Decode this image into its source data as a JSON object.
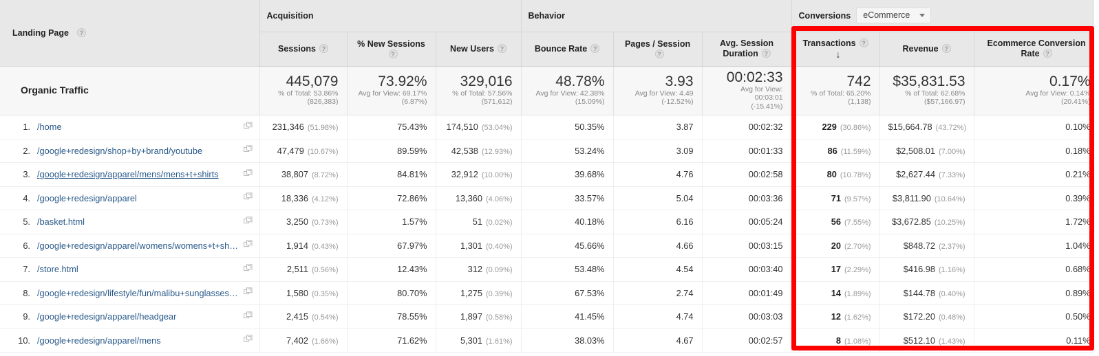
{
  "dimension": {
    "label": "Landing Page",
    "help_icon": "help-icon"
  },
  "groups": {
    "acquisition": "Acquisition",
    "behavior": "Behavior",
    "conversions": "Conversions",
    "conversions_select": "eCommerce"
  },
  "metrics": {
    "sessions": "Sessions",
    "pct_new_sessions": "% New Sessions",
    "new_users": "New Users",
    "bounce_rate": "Bounce Rate",
    "pages_session": "Pages / Session",
    "avg_session_duration": "Avg. Session Duration",
    "transactions": "Transactions",
    "revenue": "Revenue",
    "ecommerce_conversion_rate": "Ecommerce Conversion Rate"
  },
  "sort": {
    "column": "Transactions",
    "direction_icon": "arrow-down-icon",
    "direction_glyph": "↓"
  },
  "summary": {
    "label": "Organic Traffic",
    "sessions": {
      "value": "445,079",
      "line1": "% of Total: 53.86%",
      "line2": "(826,383)"
    },
    "pct_new_sessions": {
      "value": "73.92%",
      "line1": "Avg for View: 69.17%",
      "line2": "(6.87%)"
    },
    "new_users": {
      "value": "329,016",
      "line1": "% of Total: 57.56%",
      "line2": "(571,612)"
    },
    "bounce_rate": {
      "value": "48.78%",
      "line1": "Avg for View: 42.38%",
      "line2": "(15.09%)"
    },
    "pages_session": {
      "value": "3.93",
      "line1": "Avg for View: 4.49",
      "line2": "(-12.52%)"
    },
    "avg_session_duration": {
      "value": "00:02:33",
      "line1": "Avg for View: 00:03:01",
      "line2": "(-15.41%)"
    },
    "transactions": {
      "value": "742",
      "line1": "% of Total: 65.20%",
      "line2": "(1,138)"
    },
    "revenue": {
      "value": "$35,831.53",
      "line1": "% of Total: 62.68%",
      "line2": "($57,166.97)"
    },
    "ecommerce_conversion_rate": {
      "value": "0.17%",
      "line1": "Avg for View: 0.14%",
      "line2": "(20.41%)"
    }
  },
  "rows": [
    {
      "rank": "1.",
      "path": "/home",
      "hovered": false,
      "sessions": "231,346",
      "sessions_pct": "(51.98%)",
      "pct_new_sessions": "75.43%",
      "new_users": "174,510",
      "new_users_pct": "(53.04%)",
      "bounce_rate": "50.35%",
      "pages_session": "3.87",
      "avg_session_duration": "00:02:32",
      "transactions": "229",
      "transactions_pct": "(30.86%)",
      "revenue": "$15,664.78",
      "revenue_pct": "(43.72%)",
      "ecommerce_conversion_rate": "0.10%"
    },
    {
      "rank": "2.",
      "path": "/google+redesign/shop+by+brand/youtube",
      "hovered": false,
      "sessions": "47,479",
      "sessions_pct": "(10.67%)",
      "pct_new_sessions": "89.59%",
      "new_users": "42,538",
      "new_users_pct": "(12.93%)",
      "bounce_rate": "53.24%",
      "pages_session": "3.09",
      "avg_session_duration": "00:01:33",
      "transactions": "86",
      "transactions_pct": "(11.59%)",
      "revenue": "$2,508.01",
      "revenue_pct": "(7.00%)",
      "ecommerce_conversion_rate": "0.18%"
    },
    {
      "rank": "3.",
      "path": "/google+redesign/apparel/mens/mens+t+shirts",
      "hovered": true,
      "sessions": "38,807",
      "sessions_pct": "(8.72%)",
      "pct_new_sessions": "84.81%",
      "new_users": "32,912",
      "new_users_pct": "(10.00%)",
      "bounce_rate": "39.68%",
      "pages_session": "4.76",
      "avg_session_duration": "00:02:58",
      "transactions": "80",
      "transactions_pct": "(10.78%)",
      "revenue": "$2,627.44",
      "revenue_pct": "(7.33%)",
      "ecommerce_conversion_rate": "0.21%"
    },
    {
      "rank": "4.",
      "path": "/google+redesign/apparel",
      "hovered": false,
      "sessions": "18,336",
      "sessions_pct": "(4.12%)",
      "pct_new_sessions": "72.86%",
      "new_users": "13,360",
      "new_users_pct": "(4.06%)",
      "bounce_rate": "33.57%",
      "pages_session": "5.04",
      "avg_session_duration": "00:03:36",
      "transactions": "71",
      "transactions_pct": "(9.57%)",
      "revenue": "$3,811.90",
      "revenue_pct": "(10.64%)",
      "ecommerce_conversion_rate": "0.39%"
    },
    {
      "rank": "5.",
      "path": "/basket.html",
      "hovered": false,
      "sessions": "3,250",
      "sessions_pct": "(0.73%)",
      "pct_new_sessions": "1.57%",
      "new_users": "51",
      "new_users_pct": "(0.02%)",
      "bounce_rate": "40.18%",
      "pages_session": "6.16",
      "avg_session_duration": "00:05:24",
      "transactions": "56",
      "transactions_pct": "(7.55%)",
      "revenue": "$3,672.85",
      "revenue_pct": "(10.25%)",
      "ecommerce_conversion_rate": "1.72%"
    },
    {
      "rank": "6.",
      "path": "/google+redesign/apparel/womens/womens+t+shirts",
      "hovered": false,
      "sessions": "1,914",
      "sessions_pct": "(0.43%)",
      "pct_new_sessions": "67.97%",
      "new_users": "1,301",
      "new_users_pct": "(0.40%)",
      "bounce_rate": "45.66%",
      "pages_session": "4.66",
      "avg_session_duration": "00:03:15",
      "transactions": "20",
      "transactions_pct": "(2.70%)",
      "revenue": "$848.72",
      "revenue_pct": "(2.37%)",
      "ecommerce_conversion_rate": "1.04%"
    },
    {
      "rank": "7.",
      "path": "/store.html",
      "hovered": false,
      "sessions": "2,511",
      "sessions_pct": "(0.56%)",
      "pct_new_sessions": "12.43%",
      "new_users": "312",
      "new_users_pct": "(0.09%)",
      "bounce_rate": "53.48%",
      "pages_session": "4.54",
      "avg_session_duration": "00:03:40",
      "transactions": "17",
      "transactions_pct": "(2.29%)",
      "revenue": "$416.98",
      "revenue_pct": "(1.16%)",
      "ecommerce_conversion_rate": "0.68%"
    },
    {
      "rank": "8.",
      "path": "/google+redesign/lifestyle/fun/malibu+sunglasses.axd",
      "hovered": false,
      "sessions": "1,580",
      "sessions_pct": "(0.35%)",
      "pct_new_sessions": "80.70%",
      "new_users": "1,275",
      "new_users_pct": "(0.39%)",
      "bounce_rate": "67.53%",
      "pages_session": "2.74",
      "avg_session_duration": "00:01:49",
      "transactions": "14",
      "transactions_pct": "(1.89%)",
      "revenue": "$144.78",
      "revenue_pct": "(0.40%)",
      "ecommerce_conversion_rate": "0.89%"
    },
    {
      "rank": "9.",
      "path": "/google+redesign/apparel/headgear",
      "hovered": false,
      "sessions": "2,415",
      "sessions_pct": "(0.54%)",
      "pct_new_sessions": "78.55%",
      "new_users": "1,897",
      "new_users_pct": "(0.58%)",
      "bounce_rate": "41.45%",
      "pages_session": "4.74",
      "avg_session_duration": "00:03:03",
      "transactions": "12",
      "transactions_pct": "(1.62%)",
      "revenue": "$172.20",
      "revenue_pct": "(0.48%)",
      "ecommerce_conversion_rate": "0.50%"
    },
    {
      "rank": "10.",
      "path": "/google+redesign/apparel/mens",
      "hovered": false,
      "sessions": "7,402",
      "sessions_pct": "(1.66%)",
      "pct_new_sessions": "71.62%",
      "new_users": "5,301",
      "new_users_pct": "(1.61%)",
      "bounce_rate": "38.03%",
      "pages_session": "4.67",
      "avg_session_duration": "00:02:57",
      "transactions": "8",
      "transactions_pct": "(1.08%)",
      "revenue": "$512.10",
      "revenue_pct": "(1.43%)",
      "ecommerce_conversion_rate": "0.11%"
    }
  ],
  "annotation": {
    "highlight_color": "#ff0000",
    "highlight_name": "conversions-columns-highlight"
  },
  "icons": {
    "open_in_new_window": "open-in-new-window-icon",
    "help": "help-icon",
    "sort_desc": "sort-descending-icon",
    "dropdown_caret": "chevron-down-icon"
  }
}
